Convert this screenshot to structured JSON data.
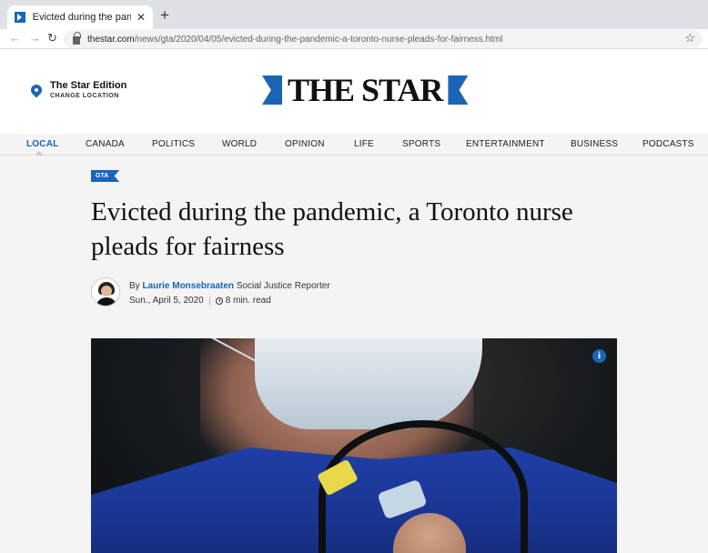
{
  "browser": {
    "tab_title": "Evicted during the pandemic, a T",
    "tab_close": "✕",
    "new_tab": "+",
    "back": "←",
    "forward": "→",
    "reload": "↻",
    "url_domain": "thestar.com",
    "url_path": "/news/gta/2020/04/05/evicted-during-the-pandemic-a-toronto-nurse-pleads-for-fairness.html",
    "bookmark": "☆"
  },
  "header": {
    "edition_title": "The Star Edition",
    "edition_sub": "CHANGE LOCATION",
    "logo": "THE STAR"
  },
  "nav": {
    "items": [
      "LOCAL",
      "CANADA",
      "POLITICS",
      "WORLD",
      "OPINION",
      "LIFE",
      "SPORTS",
      "ENTERTAINMENT",
      "BUSINESS",
      "PODCASTS"
    ]
  },
  "article": {
    "section_badge": "GTA",
    "headline": "Evicted during the pandemic, a Toronto nurse pleads for fairness",
    "by_prefix": "By",
    "author": "Laurie Monsebraaten",
    "author_role": "Social Justice Reporter",
    "date": "Sun., April 5, 2020",
    "read_time": "8 min. read",
    "info_icon": "i"
  },
  "colors": {
    "brand": "#1a65b5"
  }
}
